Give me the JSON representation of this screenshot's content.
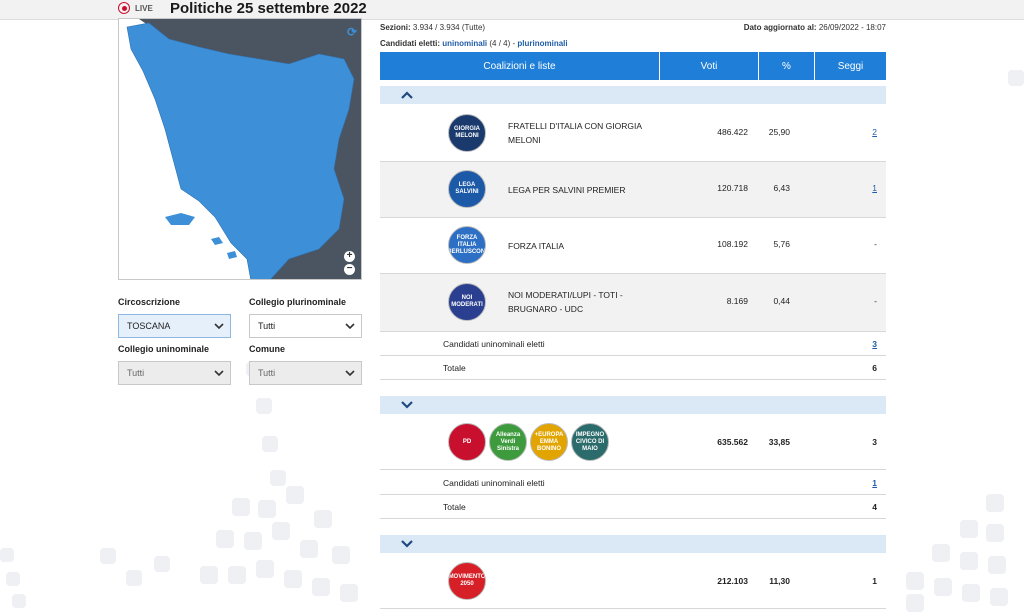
{
  "header": {
    "live_label": "LIVE",
    "title": "Politiche 25 settembre 2022"
  },
  "filters": {
    "circoscrizione": {
      "label": "Circoscrizione",
      "value": "TOSCANA"
    },
    "collegio_plurinominale": {
      "label": "Collegio plurinominale",
      "value": "Tutti"
    },
    "collegio_uninominale": {
      "label": "Collegio uninominale",
      "value": "Tutti"
    },
    "comune": {
      "label": "Comune",
      "value": "Tutti"
    }
  },
  "info": {
    "sezioni_label": "Sezioni:",
    "sezioni_value": "3.934 / 3.934 (Tutte)",
    "updated_label": "Dato aggiornato al:",
    "updated_value": "26/09/2022 - 18:07",
    "eletti_label": "Candidati eletti:",
    "uninominali_link": "uninominali",
    "uninominali_count": "(4 / 4) -",
    "plurinominali_link": "plurinominali"
  },
  "table": {
    "headers": {
      "coalizioni": "Coalizioni e liste",
      "voti": "Voti",
      "perc": "%",
      "seggi": "Seggi"
    },
    "coalition1": {
      "lists": [
        {
          "name": "FRATELLI D'ITALIA CON GIORGIA MELONI",
          "logo_text": "GIORGIA MELONI",
          "voti": "486.422",
          "perc": "25,90",
          "seggi": "2"
        },
        {
          "name": "LEGA PER SALVINI PREMIER",
          "logo_text": "LEGA SALVINI",
          "voti": "120.718",
          "perc": "6,43",
          "seggi": "1"
        },
        {
          "name": "FORZA ITALIA",
          "logo_text": "FORZA ITALIA BERLUSCONI",
          "voti": "108.192",
          "perc": "5,76",
          "seggi": "-"
        },
        {
          "name": "NOI MODERATI/LUPI - TOTI - BRUGNARO - UDC",
          "logo_text": "NOI MODERATI",
          "voti": "8.169",
          "perc": "0,44",
          "seggi": "-"
        }
      ],
      "uninominali_label": "Candidati uninominali eletti",
      "uninominali_value": "3",
      "totale_label": "Totale",
      "totale_value": "6"
    },
    "coalition2": {
      "logos": [
        "PD",
        "Alleanza Verdi Sinistra",
        "+EUROPA EMMA BONINO",
        "IMPEGNO CIVICO DI MAIO"
      ],
      "voti": "635.562",
      "perc": "33,85",
      "seggi": "3",
      "uninominali_label": "Candidati uninominali eletti",
      "uninominali_value": "1",
      "totale_label": "Totale",
      "totale_value": "4"
    },
    "coalition3": {
      "logo_text": "MOVIMENTO 2050",
      "voti": "212.103",
      "perc": "11,30",
      "seggi": "1"
    }
  },
  "colors": {
    "header_blue": "#1f7fd8",
    "map_region": "#3d8fd8",
    "map_neighbors": "#4a5561",
    "link": "#1f5da8",
    "live_red": "#c8102e"
  }
}
